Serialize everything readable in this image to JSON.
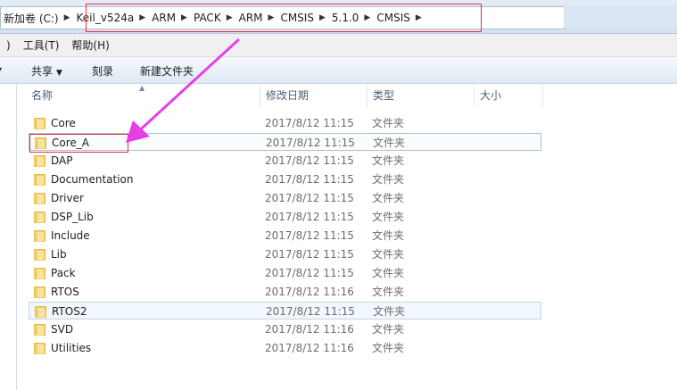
{
  "address_bar": {
    "crumbs": [
      "新加卷 (C:)",
      "Keil_v524a",
      "ARM",
      "PACK",
      "ARM",
      "CMSIS",
      "5.1.0",
      "CMSIS"
    ]
  },
  "menu": {
    "items": [
      ")",
      "工具(T)",
      "帮助(H)"
    ]
  },
  "toolbar": {
    "share_label": "共享",
    "burn_label": "刻录",
    "new_folder_label": "新建文件夹"
  },
  "columns": {
    "name": "名称",
    "modified": "修改日期",
    "type": "类型",
    "size": "大小"
  },
  "files": [
    {
      "name": "Core",
      "modified": "2017/8/12 11:15",
      "type": "文件夹"
    },
    {
      "name": "Core_A",
      "modified": "2017/8/12 11:15",
      "type": "文件夹"
    },
    {
      "name": "DAP",
      "modified": "2017/8/12 11:15",
      "type": "文件夹"
    },
    {
      "name": "Documentation",
      "modified": "2017/8/12 11:15",
      "type": "文件夹"
    },
    {
      "name": "Driver",
      "modified": "2017/8/12 11:15",
      "type": "文件夹"
    },
    {
      "name": "DSP_Lib",
      "modified": "2017/8/12 11:15",
      "type": "文件夹"
    },
    {
      "name": "Include",
      "modified": "2017/8/12 11:15",
      "type": "文件夹"
    },
    {
      "name": "Lib",
      "modified": "2017/8/12 11:15",
      "type": "文件夹"
    },
    {
      "name": "Pack",
      "modified": "2017/8/12 11:15",
      "type": "文件夹"
    },
    {
      "name": "RTOS",
      "modified": "2017/8/12 11:16",
      "type": "文件夹"
    },
    {
      "name": "RTOS2",
      "modified": "2017/8/12 11:15",
      "type": "文件夹"
    },
    {
      "name": "SVD",
      "modified": "2017/8/12 11:16",
      "type": "文件夹"
    },
    {
      "name": "Utilities",
      "modified": "2017/8/12 11:16",
      "type": "文件夹"
    }
  ],
  "highlighted_files": [
    "Core_A",
    "RTOS2"
  ],
  "icons": {
    "folder": "folder-icon",
    "breadcrumb_separator": "chevron-right-icon",
    "dropdown": "chevron-down-icon"
  },
  "colors": {
    "annotation_red": "#e8303a",
    "annotation_arrow": "#e83ee8",
    "folder_yellow": "#f2c75c"
  }
}
